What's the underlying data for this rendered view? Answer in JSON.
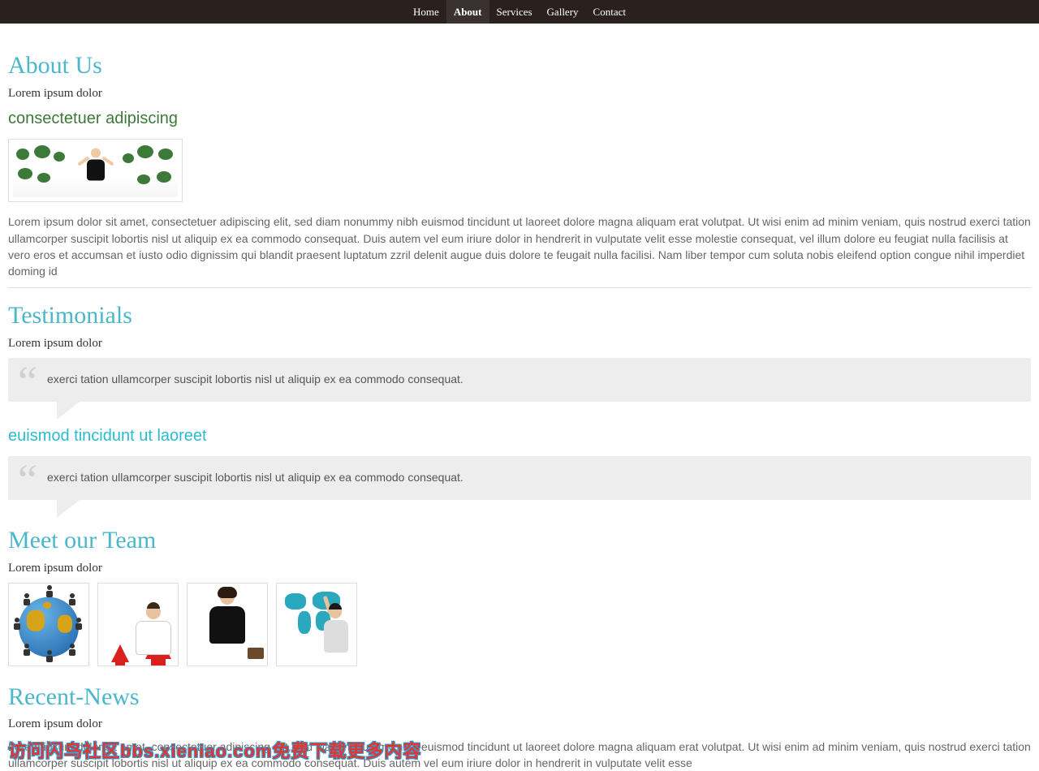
{
  "nav": {
    "items": [
      {
        "label": "Home"
      },
      {
        "label": "About"
      },
      {
        "label": "Services"
      },
      {
        "label": "Gallery"
      },
      {
        "label": "Contact"
      }
    ],
    "active_index": 1
  },
  "about": {
    "title": "About Us",
    "subtitle": "Lorem ipsum dolor",
    "green_heading": "consectetuer adipiscing",
    "body": "Lorem ipsum dolor sit amet, consectetuer adipiscing elit, sed diam nonummy nibh euismod tincidunt ut laoreet dolore magna aliquam erat volutpat. Ut wisi enim ad minim veniam, quis nostrud exerci tation ullamcorper suscipit lobortis nisl ut aliquip ex ea commodo consequat. Duis autem vel eum iriure dolor in hendrerit in vulputate velit esse molestie consequat, vel illum dolore eu feugiat nulla facilisis at vero eros et accumsan et iusto odio dignissim qui blandit praesent luptatum zzril delenit augue duis dolore te feugait nulla facilisi. Nam liber tempor cum soluta nobis eleifend option congue nihil imperdiet doming id"
  },
  "testimonials": {
    "title": "Testimonials",
    "subtitle": "Lorem ipsum dolor",
    "items": [
      {
        "quote": "exerci tation ullamcorper suscipit lobortis nisl ut aliquip ex ea commodo consequat."
      },
      {
        "quote": "exerci tation ullamcorper suscipit lobortis nisl ut aliquip ex ea commodo consequat."
      }
    ],
    "mid_link": "euismod tincidunt ut laoreet"
  },
  "team": {
    "title": "Meet our Team",
    "subtitle": "Lorem ipsum dolor"
  },
  "news": {
    "title": "Recent-News",
    "subtitle": "Lorem ipsum dolor",
    "body": "Lorem ipsum dolor sit amet, consectetuer adipiscing elit, sed diam nonummy nibh euismod tincidunt ut laoreet dolore magna aliquam erat volutpat. Ut wisi enim ad minim veniam, quis nostrud exerci tation ullamcorper suscipit lobortis nisl ut aliquip ex ea commodo consequat. Duis autem vel eum iriure dolor in hendrerit in vulputate velit esse"
  },
  "watermark": "访问闪鸟社区bbs.xieniao.com免费下载更多内容"
}
